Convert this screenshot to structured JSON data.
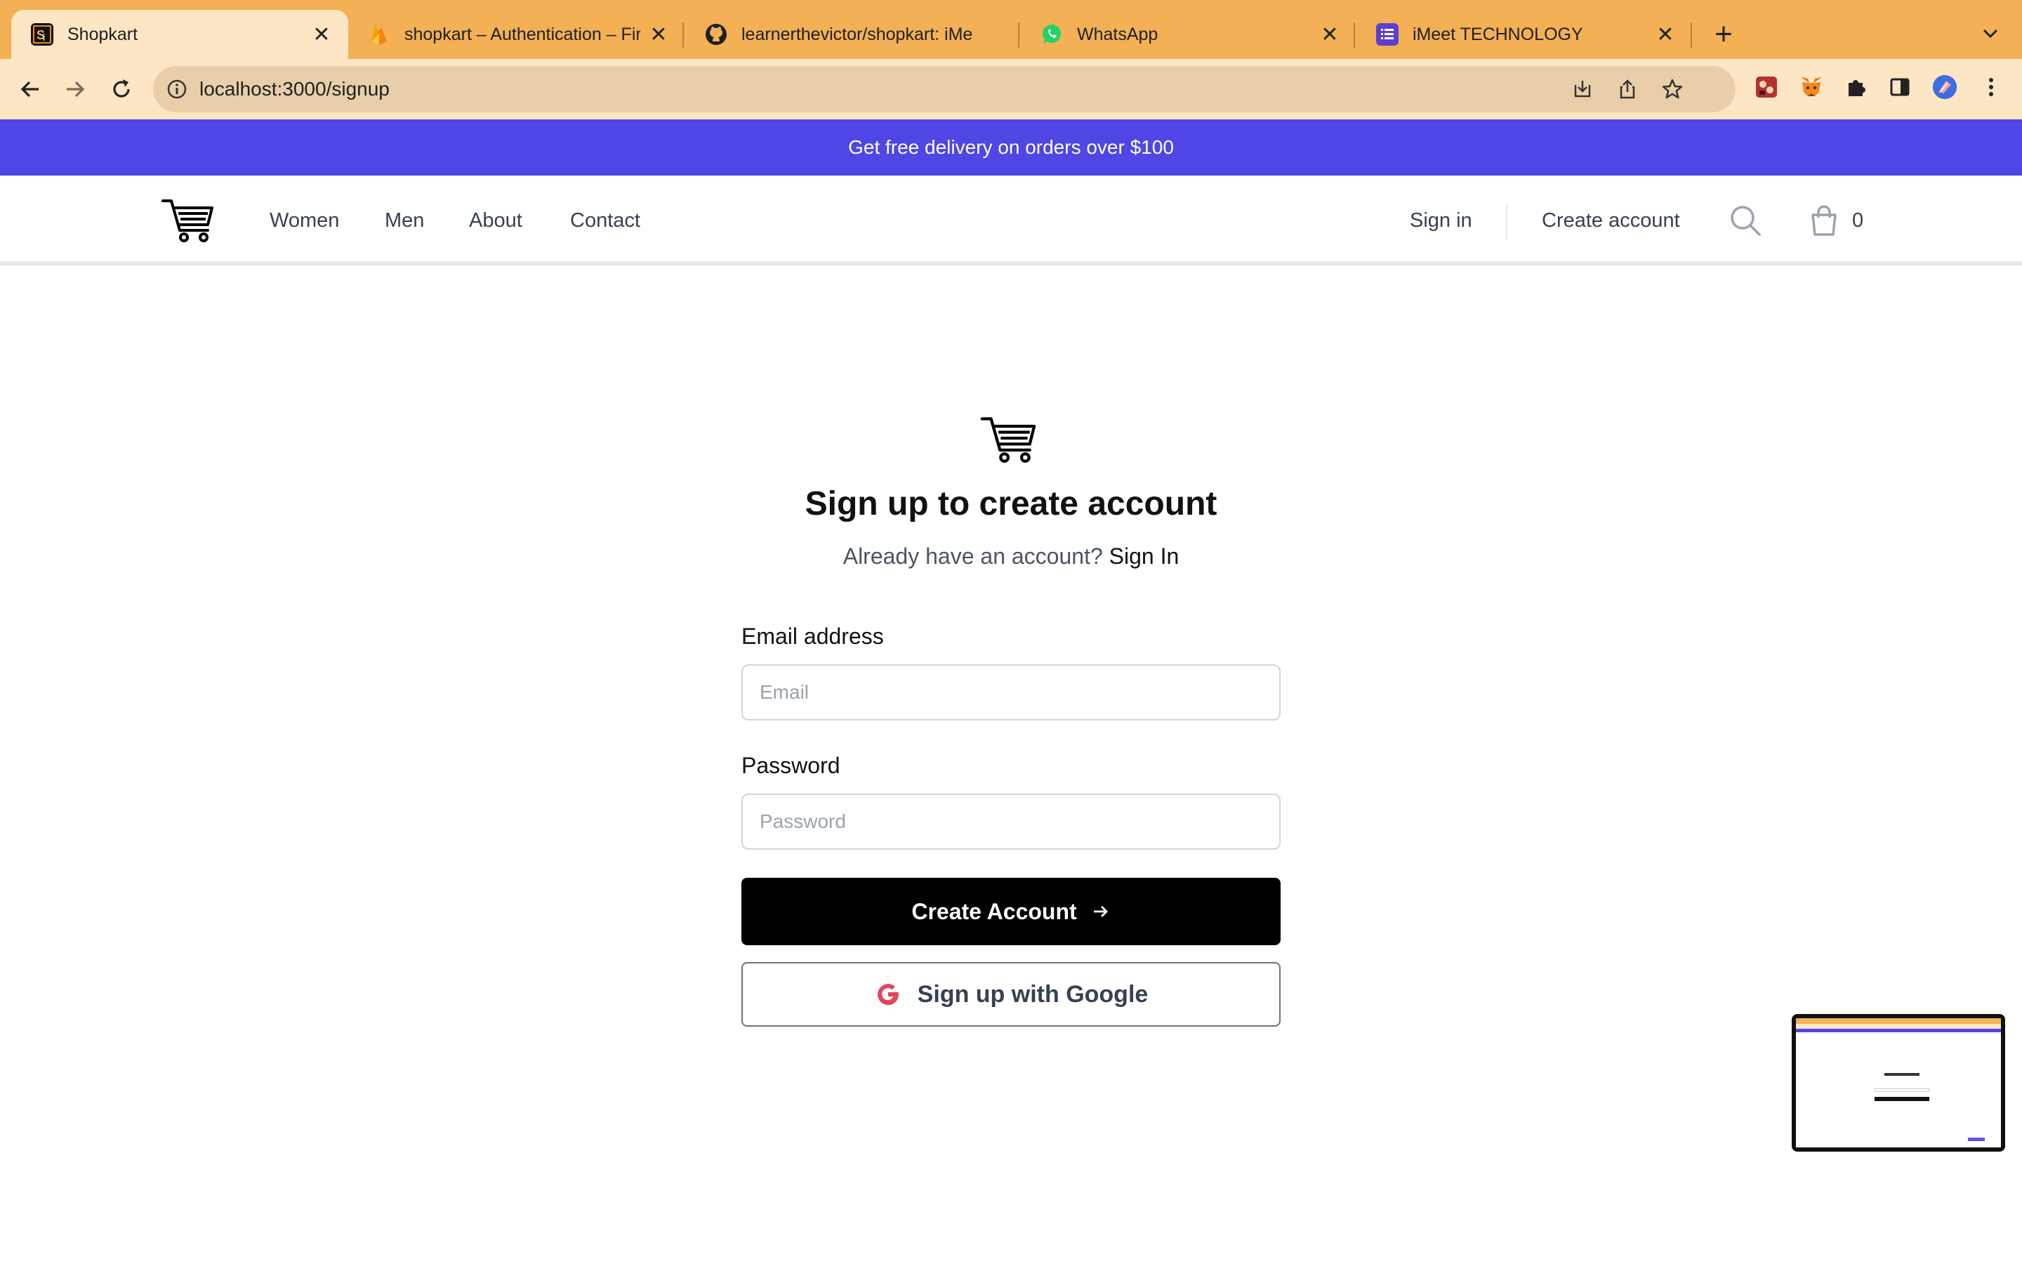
{
  "browser": {
    "tabs": [
      {
        "title": "Shopkart",
        "active": true,
        "icon": "shopkart-favicon"
      },
      {
        "title": "shopkart – Authentication – Fir",
        "active": false,
        "icon": "firebase-favicon"
      },
      {
        "title": "learnerthevictor/shopkart: iMe",
        "active": false,
        "icon": "github-favicon"
      },
      {
        "title": "WhatsApp",
        "active": false,
        "icon": "whatsapp-favicon"
      },
      {
        "title": "iMeet TECHNOLOGY",
        "active": false,
        "icon": "imeet-favicon"
      }
    ],
    "new_tab_label": "+",
    "close_glyph": "✕",
    "url": "localhost:3000/signup",
    "tab_bar_color": "#f3b055",
    "toolbar_color": "#fce6c4"
  },
  "promo": {
    "text": "Get free delivery on orders over $100",
    "color": "#4f46e5"
  },
  "header": {
    "nav": [
      {
        "label": "Women"
      },
      {
        "label": "Men"
      },
      {
        "label": "About"
      },
      {
        "label": "Contact"
      }
    ],
    "sign_in": "Sign in",
    "create_account": "Create account",
    "cart_count": "0"
  },
  "form": {
    "title": "Sign up to create account",
    "subtitle": "Already have an account?",
    "signin_link": "Sign In",
    "email_label": "Email address",
    "email_placeholder": "Email",
    "password_label": "Password",
    "password_placeholder": "Password",
    "submit_label": "Create Account",
    "google_label": "Sign up with Google"
  }
}
